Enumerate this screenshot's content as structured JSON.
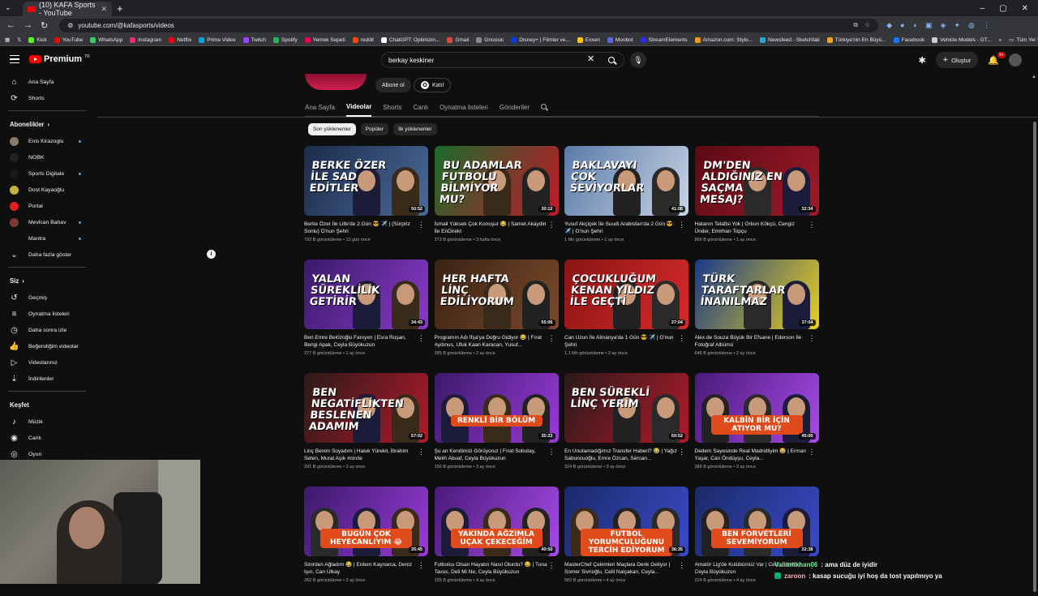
{
  "browser": {
    "tab_title": "(10) KAFA Sports - YouTube",
    "url": "youtube.com/@kafasports/videos",
    "bookmarks": [
      {
        "label": "Kick",
        "color": "#53fc18"
      },
      {
        "label": "YouTube",
        "color": "#ff0000"
      },
      {
        "label": "WhatsApp",
        "color": "#25d366"
      },
      {
        "label": "Instagram",
        "color": "#e1306c"
      },
      {
        "label": "Netflix",
        "color": "#e50914"
      },
      {
        "label": "Prime Video",
        "color": "#00a8e1"
      },
      {
        "label": "Twitch",
        "color": "#9146ff"
      },
      {
        "label": "Spotify",
        "color": "#1db954"
      },
      {
        "label": "Yemek Sepeti",
        "color": "#ea004b"
      },
      {
        "label": "reddit",
        "color": "#ff4500"
      },
      {
        "label": "ChatGPT: Optimizin...",
        "color": "#ffffff"
      },
      {
        "label": "Gmail",
        "color": "#ea4335"
      },
      {
        "label": "Gnoosic",
        "color": "#888888"
      },
      {
        "label": "Disney+ | Filmler ve...",
        "color": "#113ccf"
      },
      {
        "label": "Exxen",
        "color": "#f5c518"
      },
      {
        "label": "Moobot",
        "color": "#5865f2"
      },
      {
        "label": "StreamElements",
        "color": "#2e2edc"
      },
      {
        "label": "Amazon.com: Stylo...",
        "color": "#ff9900"
      },
      {
        "label": "Newsfeed - Sketchfab",
        "color": "#1caad9"
      },
      {
        "label": "Türkiye'nin En Büyü...",
        "color": "#f0a030"
      },
      {
        "label": "Facebook",
        "color": "#1877f2"
      },
      {
        "label": "Vehicle Models - GT...",
        "color": "#cccccc"
      }
    ],
    "all_bookmarks": "Tüm Yer İşaretleri"
  },
  "masthead": {
    "logo_text": "Premium",
    "logo_tr": "TR",
    "search_value": "berkay keskiner",
    "create_label": "Oluştur",
    "notif_count": "9+"
  },
  "sidebar": {
    "main": [
      {
        "label": "Ana Sayfa",
        "icon": "⌂",
        "name": "home"
      },
      {
        "label": "Shorts",
        "icon": "⟳",
        "name": "shorts"
      }
    ],
    "subs_header": "Abonelikler",
    "subs": [
      {
        "label": "Enis Kirazoglu",
        "color": "#8a7a6a",
        "dot": true
      },
      {
        "label": "NOBK",
        "color": "#222222",
        "dot": false
      },
      {
        "label": "Sports Digitale",
        "color": "#1a1a1a",
        "dot": true
      },
      {
        "label": "Dost Kayaoğlu",
        "color": "#c8b040",
        "dot": false
      },
      {
        "label": "Portal",
        "color": "#e02020",
        "dot": false
      },
      {
        "label": "Mevlcan Bahav",
        "color": "#7a3a3a",
        "dot": true
      },
      {
        "label": "Mantra",
        "color": "#0f0f0f",
        "dot": true
      }
    ],
    "show_more": "Daha fazla göster",
    "you_header": "Siz",
    "you": [
      {
        "label": "Geçmiş",
        "icon": "↺",
        "name": "history"
      },
      {
        "label": "Oynatma listeleri",
        "icon": "≡",
        "name": "playlists"
      },
      {
        "label": "Daha sonra izle",
        "icon": "◷",
        "name": "watch-later"
      },
      {
        "label": "Beğendiğim videolar",
        "icon": "👍",
        "name": "liked"
      },
      {
        "label": "Videolarınız",
        "icon": "▷",
        "name": "your-videos"
      },
      {
        "label": "İndirilenler",
        "icon": "⇣",
        "name": "downloads"
      }
    ],
    "explore_header": "Keşfet",
    "explore": [
      {
        "label": "Müzik",
        "icon": "♪",
        "name": "music"
      },
      {
        "label": "Canlı",
        "icon": "◉",
        "name": "live"
      },
      {
        "label": "Oyun",
        "icon": "◎",
        "name": "gaming"
      }
    ]
  },
  "channel": {
    "subscribe_label": "Abone ol",
    "join_label": "Katıl",
    "tabs": [
      "Ana Sayfa",
      "Videolar",
      "Shorts",
      "Canlı",
      "Oynatma listeleri",
      "Gönderiler"
    ],
    "active_tab": "Videolar",
    "chips": [
      "Son yüklenenler",
      "Popüler",
      "İlk yüklenenler"
    ]
  },
  "videos": [
    {
      "title": "Berke Özer İle Lille'de 2 Gün 😎 ✈️ | (Sürpriz Sonlu) O'nun Şehri",
      "meta": "792 B görüntüleme • 13 gün önce",
      "duration": "50:52",
      "thumb_text": "BERKE ÖZER İLE SAD EDİTLER",
      "bg": "#1c2b4a",
      "bg2": "#4a6a9a",
      "pill": false
    },
    {
      "title": "İsmail Yüksek Çok Konuşur 😂 | Samet Akaydin İle EnDirekt",
      "meta": "373 B görüntüleme • 3 hafta önce",
      "duration": "30:12",
      "thumb_text": "BU ADAMLAR FUTBOLU BİLMİYOR MU?",
      "bg": "#1a6a2a",
      "bg2": "#c01a2a",
      "pill": false
    },
    {
      "title": "Yusuf Akçiçek İle Suudi Arabistan'da 2 Gün 😎 ✈️ | O'nun Şehri",
      "meta": "1 Mn görüntüleme • 1 ay önce",
      "duration": "41:08",
      "thumb_text": "BAKLAVAYI ÇOK SEVİYORLAR",
      "bg": "#5a7aa8",
      "bg2": "#c8d4e4",
      "pill": false
    },
    {
      "title": "Hatanın Telafisi Yok | Orkun Kökçü, Cengiz Ünder, Emirhan Topçu",
      "meta": "866 B görüntüleme • 1 ay önce",
      "duration": "32:34",
      "thumb_text": "DM'DEN ALDIĞINIZ EN SAÇMA MESAJ?",
      "bg": "#5a0a14",
      "bg2": "#a01a2a",
      "pill": false
    },
    {
      "title": "Ben Emre Belözoğlu Fanıyım | Esra Ruşan, Bengi Apak, Ceyla Büyükuzun",
      "meta": "277 B görüntüleme • 1 ay önce",
      "duration": "34:43",
      "thumb_text": "YALAN SÜREKLİLİK GETİRİR",
      "bg": "#3a1a6a",
      "bg2": "#8a3ac8",
      "pill": false
    },
    {
      "title": "Programın Adı İfşa'ya Doğru Gidiyor 😂 | Fırat Aydınus, Ufuk Kaan Karacan, Yusuf...",
      "meta": "285 B görüntüleme • 2 ay önce",
      "duration": "55:06",
      "thumb_text": "HER HAFTA LİNÇ EDİLİYORUM",
      "bg": "#3a2214",
      "bg2": "#7a4a2a",
      "pill": false
    },
    {
      "title": "Can Uzun İle Almanya'da 1 Gün 😎 ✈️ | O'nun Şehri",
      "meta": "1,1 Mn görüntüleme • 2 ay önce",
      "duration": "27:04",
      "thumb_text": "ÇOCUKLUĞUM KENAN YILDIZ İLE GEÇTİ",
      "bg": "#8a1414",
      "bg2": "#d82a2a",
      "pill": false
    },
    {
      "title": "Alex de Souza Büyük Bir Efsane | Ederson İle Fotoğraf Albümü",
      "meta": "648 B görüntüleme • 2 ay önce",
      "duration": "37:04",
      "thumb_text": "TÜRK TARAFTARLAR İNANILMAZ",
      "bg": "#1a3a8a",
      "bg2": "#e8d020",
      "pill": false
    },
    {
      "title": "Linç Benim Soyadım | Haluk Yürekli, İbrahim Seten, Murat Aşık #circle",
      "meta": "291 B görüntüleme • 2 ay önce",
      "duration": "57:02",
      "thumb_text": "BEN NEGATİFLİKTEN BESLENEN ADAMIM",
      "bg": "#2a1a1a",
      "bg2": "#b01a2a",
      "pill": false
    },
    {
      "title": "Şu an Kendimizi Görüyoruz | Fırat Sobutay, Melih Abuaf, Ceyla Büyükuzun",
      "meta": "156 B görüntüleme • 3 ay önce",
      "duration": "35:23",
      "thumb_text": "RENKLİ BİR BÖLÜM",
      "bg": "#3a1a6a",
      "bg2": "#9a3ad8",
      "pill": true
    },
    {
      "title": "En Unutamadığımız Transfer Haberi? 😂 | Yağız Sabuncuoğlu, Emre Özcan, Sercan...",
      "meta": "324 B görüntüleme • 3 ay önce",
      "duration": "50:52",
      "thumb_text": "BEN SÜREKLİ LİNÇ YERİM",
      "bg": "#2a1a1a",
      "bg2": "#b01a2a",
      "pill": false
    },
    {
      "title": "Dedem Sayesinde Real Madridliyim 😂 | Erman Yaşar, Can Öndüyşu, Ceyla...",
      "meta": "386 B görüntüleme • 3 ay önce",
      "duration": "45:00",
      "thumb_text": "KALBİN BİR İÇİN ATIYOR MU?",
      "bg": "#4a1a7a",
      "bg2": "#a84ae8",
      "pill": true
    },
    {
      "title": "Sinirden Ağladım 😂 | Erdem Kaynarca, Deniz Işın, Can Ulkay",
      "meta": "282 B görüntüleme • 3 ay önce",
      "duration": "35:45",
      "thumb_text": "BUGÜN ÇOK HEYECANLIYIM 😂",
      "bg": "#3a1a6a",
      "bg2": "#9a3ad8",
      "pill": true
    },
    {
      "title": "Futbolcu Olsan Hayatın Nasıl Olurdu? 😂 | Tuna Tavus, Deli Mi Ne, Ceyla Büyükuzun",
      "meta": "155 B görüntüleme • 4 ay önce",
      "duration": "40:50",
      "thumb_text": "YAKINDA AĞZIMLA UÇAK ÇEKECEĞİM",
      "bg": "#4a1a7a",
      "bg2": "#a84ae8",
      "pill": true
    },
    {
      "title": "MasterChef Çekimleri Maçlara Denk Geliyor | Somer Sivrioğlu, Celil Nalçakan, Ceyla...",
      "meta": "582 B görüntüleme • 4 ay önce",
      "duration": "36:35",
      "thumb_text": "FUTBOL YORUMCULUĞUNU TERCİH EDİYORUM",
      "bg": "#1a2a6a",
      "bg2": "#3a4ac8",
      "pill": true
    },
    {
      "title": "Amatör Lig'de Kulübümüz Var | Celil... Walker, Ceyla Büyükuzun",
      "meta": "224 B görüntüleme • 4 ay önce",
      "duration": "32:38",
      "thumb_text": "BEN FORVETLERİ SEVEMİYORUM",
      "bg": "#1a2a6a",
      "bg2": "#3a4ac8",
      "pill": true
    }
  ],
  "chat": [
    {
      "user": "Valiantkhan06",
      "msg": ": ama düz de iyidir",
      "color": "g"
    },
    {
      "user": "zaroon",
      "msg": ": kasap sucuğu iyi hoş da tost yapılmıyo ya",
      "color": "p"
    }
  ]
}
